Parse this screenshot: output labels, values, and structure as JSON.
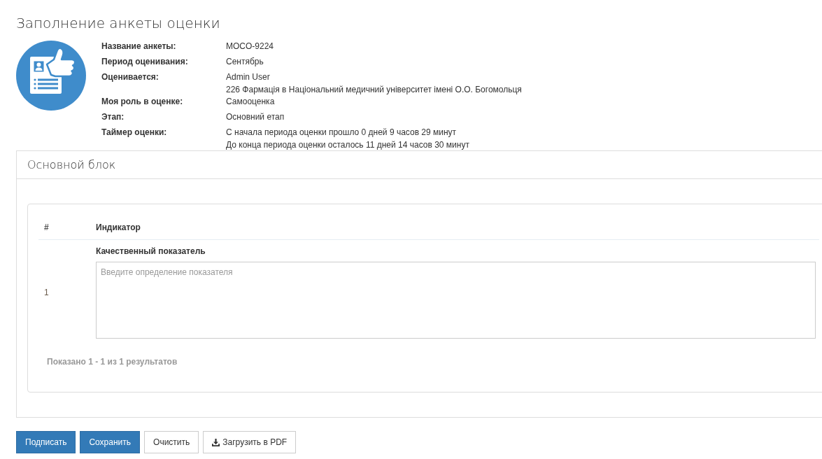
{
  "page": {
    "title": "Заполнение анкеты оценки"
  },
  "assessment_info": [
    {
      "label": "Название анкеты:",
      "lines": [
        "MOCO-9224"
      ]
    },
    {
      "label": "Период оценивания:",
      "lines": [
        "Сентябрь"
      ]
    },
    {
      "label": "Оценивается:",
      "lines": [
        "Admin User",
        "226 Фармація в Національний медичний університет імені О.О. Богомольця"
      ]
    },
    {
      "label": "Моя роль в оценке:",
      "lines": [
        "Самооценка"
      ]
    },
    {
      "label": "Этап:",
      "lines": [
        "Основний етап"
      ]
    },
    {
      "label": "Таймер оценки:",
      "lines": [
        "С начала периода оценки прошло 0 дней 9 часов 29 минут",
        "До конца периода оценки осталось 11 дней 14 часов 30 минут"
      ]
    }
  ],
  "panel": {
    "title": "Основной блок",
    "table": {
      "columns": [
        "#",
        "Индикатор"
      ],
      "rows": [
        {
          "number": "1",
          "indicator": "Качественный показатель",
          "input": {
            "placeholder": "Введите определение показателя"
          }
        }
      ]
    },
    "footer": "Показано 1 - 1 из 1 результатов"
  },
  "buttons": [
    {
      "label": "Подписать",
      "kind": "primary"
    },
    {
      "label": "Сохранить",
      "kind": "primary"
    },
    {
      "label": "Очистить",
      "kind": "plain"
    },
    {
      "label": "Загрузить в PDF",
      "kind": "icon"
    }
  ]
}
